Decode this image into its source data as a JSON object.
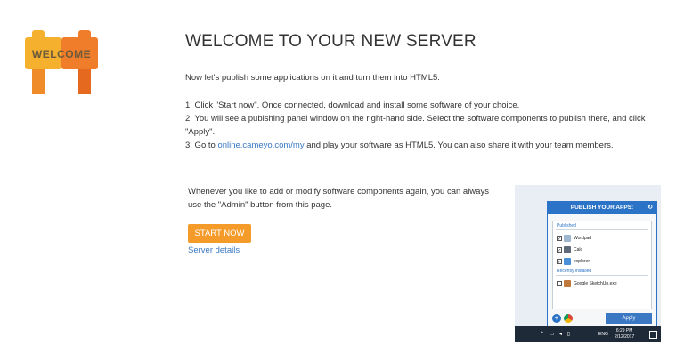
{
  "logo": {
    "text": "WELCOME",
    "colors": {
      "left": "#f5b02e",
      "right": "#f07d2a",
      "legs_left": "#f08b2a",
      "legs_right": "#e5691e",
      "text": "#6b5a3c"
    }
  },
  "header": {
    "title": "WELCOME TO YOUR NEW SERVER"
  },
  "intro": "Now let's publish some applications on it and turn them into HTML5:",
  "steps": {
    "step1": "1. Click \"Start now\". Once connected, download and install some software of your choice.",
    "step2": "2. You will see a pubishing panel window on the right-hand side. Select the software components to publish there, and click \"Apply\".",
    "step3_prefix": "3. Go to ",
    "step3_link": "online.cameyo.com/my",
    "step3_suffix": " and play your software as HTML5. You can also share it with your team members."
  },
  "note": "Whenever you like to add or modify software components again, you can always use the \"Admin\" button from this page.",
  "actions": {
    "start_label": "START NOW",
    "server_details_label": "Server details"
  },
  "preview": {
    "panel_title": "PUBLISH YOUR APPS:",
    "refresh_icon": "↻",
    "published_label": "Published",
    "published_items": [
      "Wordpad",
      "Calc",
      "explorer"
    ],
    "recent_label": "Recently installed",
    "recent_items": [
      "Google SketchUp.exe"
    ],
    "apply_label": "Apply",
    "taskbar": {
      "lang": "ENG",
      "time": "6:29 PM",
      "date": "2/12/2017"
    }
  },
  "colors": {
    "accent_orange": "#f49b2a",
    "link_blue": "#3a78c3",
    "panel_blue": "#2b73c6"
  }
}
